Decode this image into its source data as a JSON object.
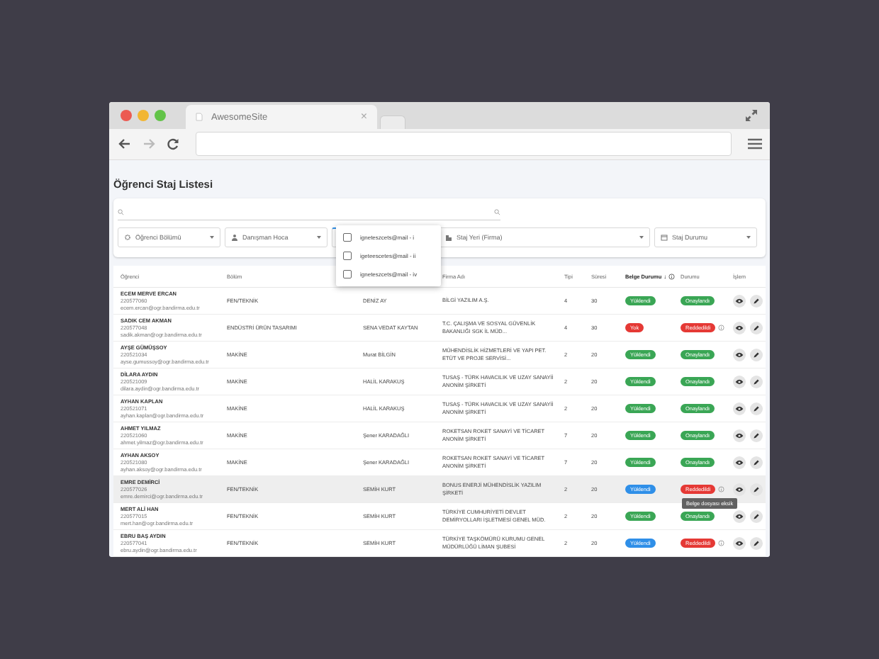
{
  "browser": {
    "tab_title": "AwesomeSite",
    "tab_close": "×"
  },
  "page": {
    "title": "Öğrenci Staj Listesi"
  },
  "filters": [
    {
      "placeholder": "Öğrenci Bölümü",
      "open": false
    },
    {
      "placeholder": "Danışman Hoca",
      "open": false
    },
    {
      "open": true,
      "options": [
        {
          "label": "igneteszcets@mail - i",
          "checked": false
        },
        {
          "label": "igeteescetes@mail - ii",
          "checked": false
        },
        {
          "label": "igneteszcets@mail - iv",
          "checked": false
        }
      ]
    },
    {
      "placeholder": "Staj Yeri (Firma)",
      "open": false
    },
    {
      "placeholder": "Staj Durumu",
      "open": false
    }
  ],
  "table": {
    "columns": [
      "Öğrenci",
      "Bölüm",
      "",
      "Firma Adı",
      "Tipi",
      "Süresi",
      "Belge Durumu",
      "Durumu",
      "İşlem"
    ],
    "sort_arrow": "↓",
    "rows": [
      {
        "selected": false,
        "name": "ECEM MERVE ERCAN",
        "number": "220577060",
        "email": "ecem.ercan@ogr.bandirma.edu.tr",
        "department": "FEN/TEKNİK",
        "advisor": "DENİZ AY",
        "company": "BİLGİ YAZILIM A.Ş.",
        "type": "4",
        "duration": "30",
        "document": {
          "text": "Yüklendi",
          "color": "#3aa655"
        },
        "status": {
          "text": "Onaylandı",
          "color": "#3aa655",
          "info": false
        }
      },
      {
        "selected": false,
        "name": "SADIK CEM AKMAN",
        "number": "220577048",
        "email": "sadik.akman@ogr.bandirma.edu.tr",
        "department": "ENDÜSTRİ ÜRÜN TASARIMI",
        "advisor": "SENA VEDAT KAYTAN",
        "company": "T.C. ÇALIŞMA VE SOSYAL GÜVENLİK BAKANLIĞI SGK İL MÜD...",
        "type": "4",
        "duration": "30",
        "document": {
          "text": "Yok",
          "color": "#e53935"
        },
        "status": {
          "text": "Reddedildi",
          "color": "#e53935",
          "info": true
        }
      },
      {
        "selected": false,
        "name": "AYŞE GÜMÜŞSOY",
        "number": "220521034",
        "email": "ayse.gumussoy@ogr.bandirma.edu.tr",
        "department": "MAKİNE",
        "advisor": "Murat BİLGİN",
        "company": "MÜHENDİSLİK HİZMETLERİ VE YAPI PET. ETÜT VE PROJE SERVİSİ...",
        "type": "2",
        "duration": "20",
        "document": {
          "text": "Yüklendi",
          "color": "#3aa655"
        },
        "status": {
          "text": "Onaylandı",
          "color": "#3aa655",
          "info": false
        }
      },
      {
        "selected": false,
        "name": "DİLARA AYDIN",
        "number": "220521009",
        "email": "dilara.aydin@ogr.bandirma.edu.tr",
        "department": "MAKİNE",
        "advisor": "HALİL KARAKUŞ",
        "company": "TUSAŞ - TÜRK HAVACILIK VE UZAY SANAYİİ ANONİM ŞİRKETİ",
        "type": "2",
        "duration": "20",
        "document": {
          "text": "Yüklendi",
          "color": "#3aa655"
        },
        "status": {
          "text": "Onaylandı",
          "color": "#3aa655",
          "info": false
        }
      },
      {
        "selected": false,
        "name": "AYHAN KAPLAN",
        "number": "220521071",
        "email": "ayhan.kaplan@ogr.bandirma.edu.tr",
        "department": "MAKİNE",
        "advisor": "HALİL KARAKUŞ",
        "company": "TUSAŞ - TÜRK HAVACILIK VE UZAY SANAYİİ ANONİM ŞİRKETİ",
        "type": "2",
        "duration": "20",
        "document": {
          "text": "Yüklendi",
          "color": "#3aa655"
        },
        "status": {
          "text": "Onaylandı",
          "color": "#3aa655",
          "info": false
        }
      },
      {
        "selected": false,
        "name": "AHMET YILMAZ",
        "number": "220521060",
        "email": "ahmet.yilmaz@ogr.bandirma.edu.tr",
        "department": "MAKİNE",
        "advisor": "Şener KARADAĞLI",
        "company": "ROKETSAN ROKET SANAYİ VE TİCARET ANONİM ŞİRKETİ",
        "type": "7",
        "duration": "20",
        "document": {
          "text": "Yüklendi",
          "color": "#3aa655"
        },
        "status": {
          "text": "Onaylandı",
          "color": "#3aa655",
          "info": false
        }
      },
      {
        "selected": false,
        "name": "AYHAN AKSOY",
        "number": "220521080",
        "email": "ayhan.aksoy@ogr.bandirma.edu.tr",
        "department": "MAKİNE",
        "advisor": "Şener KARADAĞLI",
        "company": "ROKETSAN ROKET SANAYİ VE TİCARET ANONİM ŞİRKETİ",
        "type": "7",
        "duration": "20",
        "document": {
          "text": "Yüklendi",
          "color": "#3aa655"
        },
        "status": {
          "text": "Onaylandı",
          "color": "#3aa655",
          "info": false
        }
      },
      {
        "selected": true,
        "name": "EMRE DEMİRCİ",
        "number": "220577026",
        "email": "emre.demirci@ogr.bandirma.edu.tr",
        "department": "FEN/TEKNİK",
        "advisor": "SEMİH KURT",
        "company": "BONUS ENERJİ MÜHENDİSLİK YAZILIM ŞİRKETİ",
        "type": "2",
        "duration": "20",
        "document": {
          "text": "Yüklendi",
          "color": "#2f8fe8"
        },
        "status": {
          "text": "Reddedildi",
          "color": "#e53935",
          "info": true,
          "tooltip": "Belge dosyası eksik"
        }
      },
      {
        "selected": false,
        "name": "MERT ALİ HAN",
        "number": "220577015",
        "email": "mert.han@ogr.bandirma.edu.tr",
        "department": "FEN/TEKNİK",
        "advisor": "SEMİH KURT",
        "company": "TÜRKİYE CUMHURİYETİ DEVLET DEMİRYOLLARI İŞLETMESİ GENEL MÜD.",
        "type": "2",
        "duration": "20",
        "document": {
          "text": "Yüklendi",
          "color": "#3aa655"
        },
        "status": {
          "text": "Onaylandı",
          "color": "#3aa655",
          "info": false
        }
      },
      {
        "selected": false,
        "name": "EBRU BAŞ AYDIN",
        "number": "220577041",
        "email": "ebru.aydin@ogr.bandirma.edu.tr",
        "department": "FEN/TEKNİK",
        "advisor": "SEMİH KURT",
        "company": "TÜRKİYE TAŞKÖMÜRÜ KURUMU GENEL MÜDÜRLÜĞÜ LİMAN ŞUBESİ",
        "type": "2",
        "duration": "20",
        "document": {
          "text": "Yüklendi",
          "color": "#2f8fe8"
        },
        "status": {
          "text": "Reddedildi",
          "color": "#e53935",
          "info": true
        }
      }
    ]
  }
}
